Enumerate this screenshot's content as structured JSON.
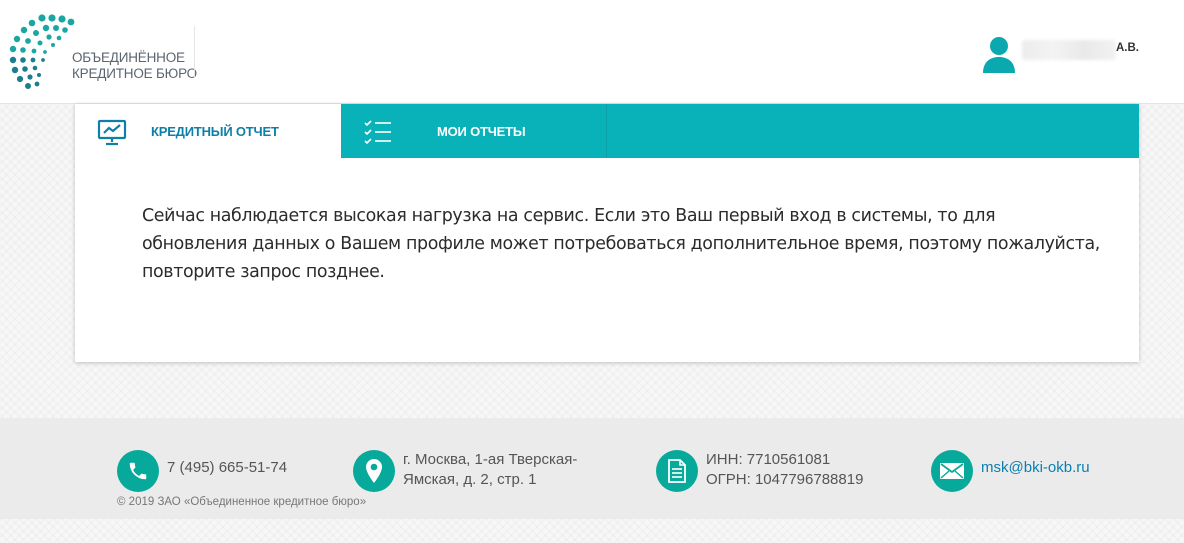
{
  "header": {
    "logo": {
      "line1": "ОБЪЕДИНЁННОЕ",
      "line2": "КРЕДИТНОЕ БЮРО"
    },
    "user": {
      "initials": "А.В."
    }
  },
  "tabs": [
    {
      "label": "КРЕДИТНЫЙ ОТЧЕТ",
      "icon": "chart-presentation-icon",
      "active": true
    },
    {
      "label": "МОИ ОТЧЕТЫ",
      "icon": "checklist-icon",
      "active": false
    }
  ],
  "message": "Сейчас наблюдается высокая нагрузка на сервис. Если это Ваш первый вход в системы, то для обновления данных о Вашем профиле может потребоваться дополнительное время, поэтому пожалуйста, повторите запрос позднее.",
  "footer": {
    "phone": {
      "icon": "phone-icon",
      "text": "7 (495) 665-51-74"
    },
    "address": {
      "icon": "location-pin-icon",
      "line1": "г. Москва, 1-ая Тверская-",
      "line2": "Ямская, д. 2, стр. 1"
    },
    "requisites": {
      "icon": "document-icon",
      "line1": "ИНН: 7710561081",
      "line2": "ОГРН: 1047796788819"
    },
    "email": {
      "icon": "envelope-icon",
      "text": "msk@bki-okb.ru"
    },
    "copyright": "© 2019 ЗАО «Объединенное кредитное бюро»"
  },
  "colors": {
    "teal": "#09b1b8",
    "footer_teal": "#07a99a",
    "active_tab_text": "#0d7fa8",
    "link": "#0b7fb0"
  }
}
